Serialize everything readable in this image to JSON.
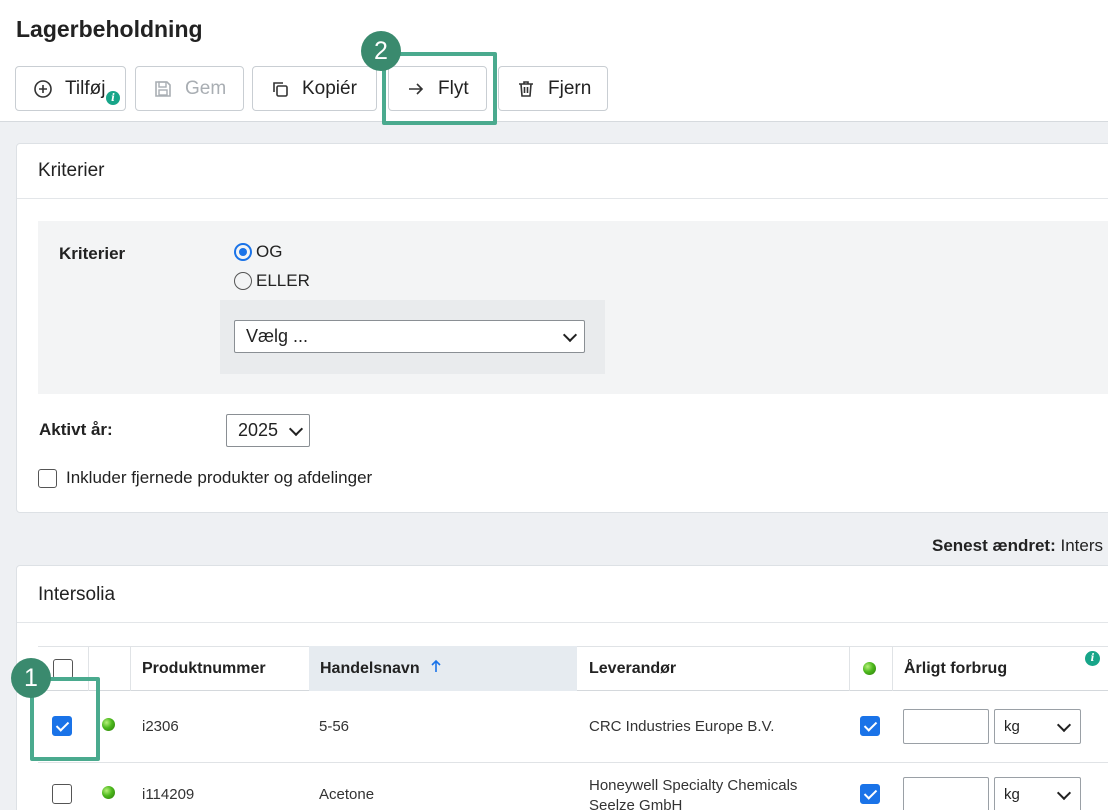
{
  "page": {
    "title": "Lagerbeholdning"
  },
  "toolbar": {
    "add": {
      "label": "Tilføj",
      "icon": "plus-circle-icon",
      "info": "i"
    },
    "save": {
      "label": "Gem",
      "icon": "floppy-disk-icon"
    },
    "copy": {
      "label": "Kopiér",
      "icon": "copy-icon"
    },
    "move": {
      "label": "Flyt",
      "icon": "arrow-right-icon"
    },
    "remove": {
      "label": "Fjern",
      "icon": "trash-icon"
    }
  },
  "annotations": {
    "step1": "1",
    "step2": "2",
    "highlight_color": "#4aaa8e"
  },
  "criteria_card": {
    "title": "Kriterier",
    "criteria_label": "Kriterier",
    "options": [
      "OG",
      "ELLER"
    ],
    "selected_option": "OG",
    "select_placeholder": "Vælg ...",
    "year_label": "Aktivt år:",
    "year_value": "2025",
    "include_removed_label": "Inkluder fjernede produkter og afdelinger",
    "include_removed_checked": false
  },
  "last_changed": {
    "label": "Senest ændret:",
    "value": "Inters"
  },
  "table_card": {
    "title": "Intersolia",
    "columns": {
      "product_number": "Produktnummer",
      "trade_name": "Handelsnavn",
      "supplier": "Leverandør",
      "annual_usage": "Årligt forbrug"
    },
    "sort_column": "Handelsnavn",
    "sort_icon": "arrow-up-icon",
    "info": "i",
    "rows": [
      {
        "selected": true,
        "product_number": "i2306",
        "trade_name": "5-56",
        "supplier": "CRC Industries Europe B.V.",
        "supplier_line2": "",
        "flag": true,
        "usage": "",
        "unit": "kg"
      },
      {
        "selected": false,
        "product_number": "i114209",
        "trade_name": "Acetone",
        "supplier": "Honeywell Specialty Chemicals",
        "supplier_line2": "Seelze GmbH",
        "flag": true,
        "usage": "",
        "unit": "kg"
      }
    ]
  },
  "colors": {
    "accent": "#1a73e8",
    "status_green": "#4cb81c",
    "sort_header_bg": "#e6ebf0"
  }
}
